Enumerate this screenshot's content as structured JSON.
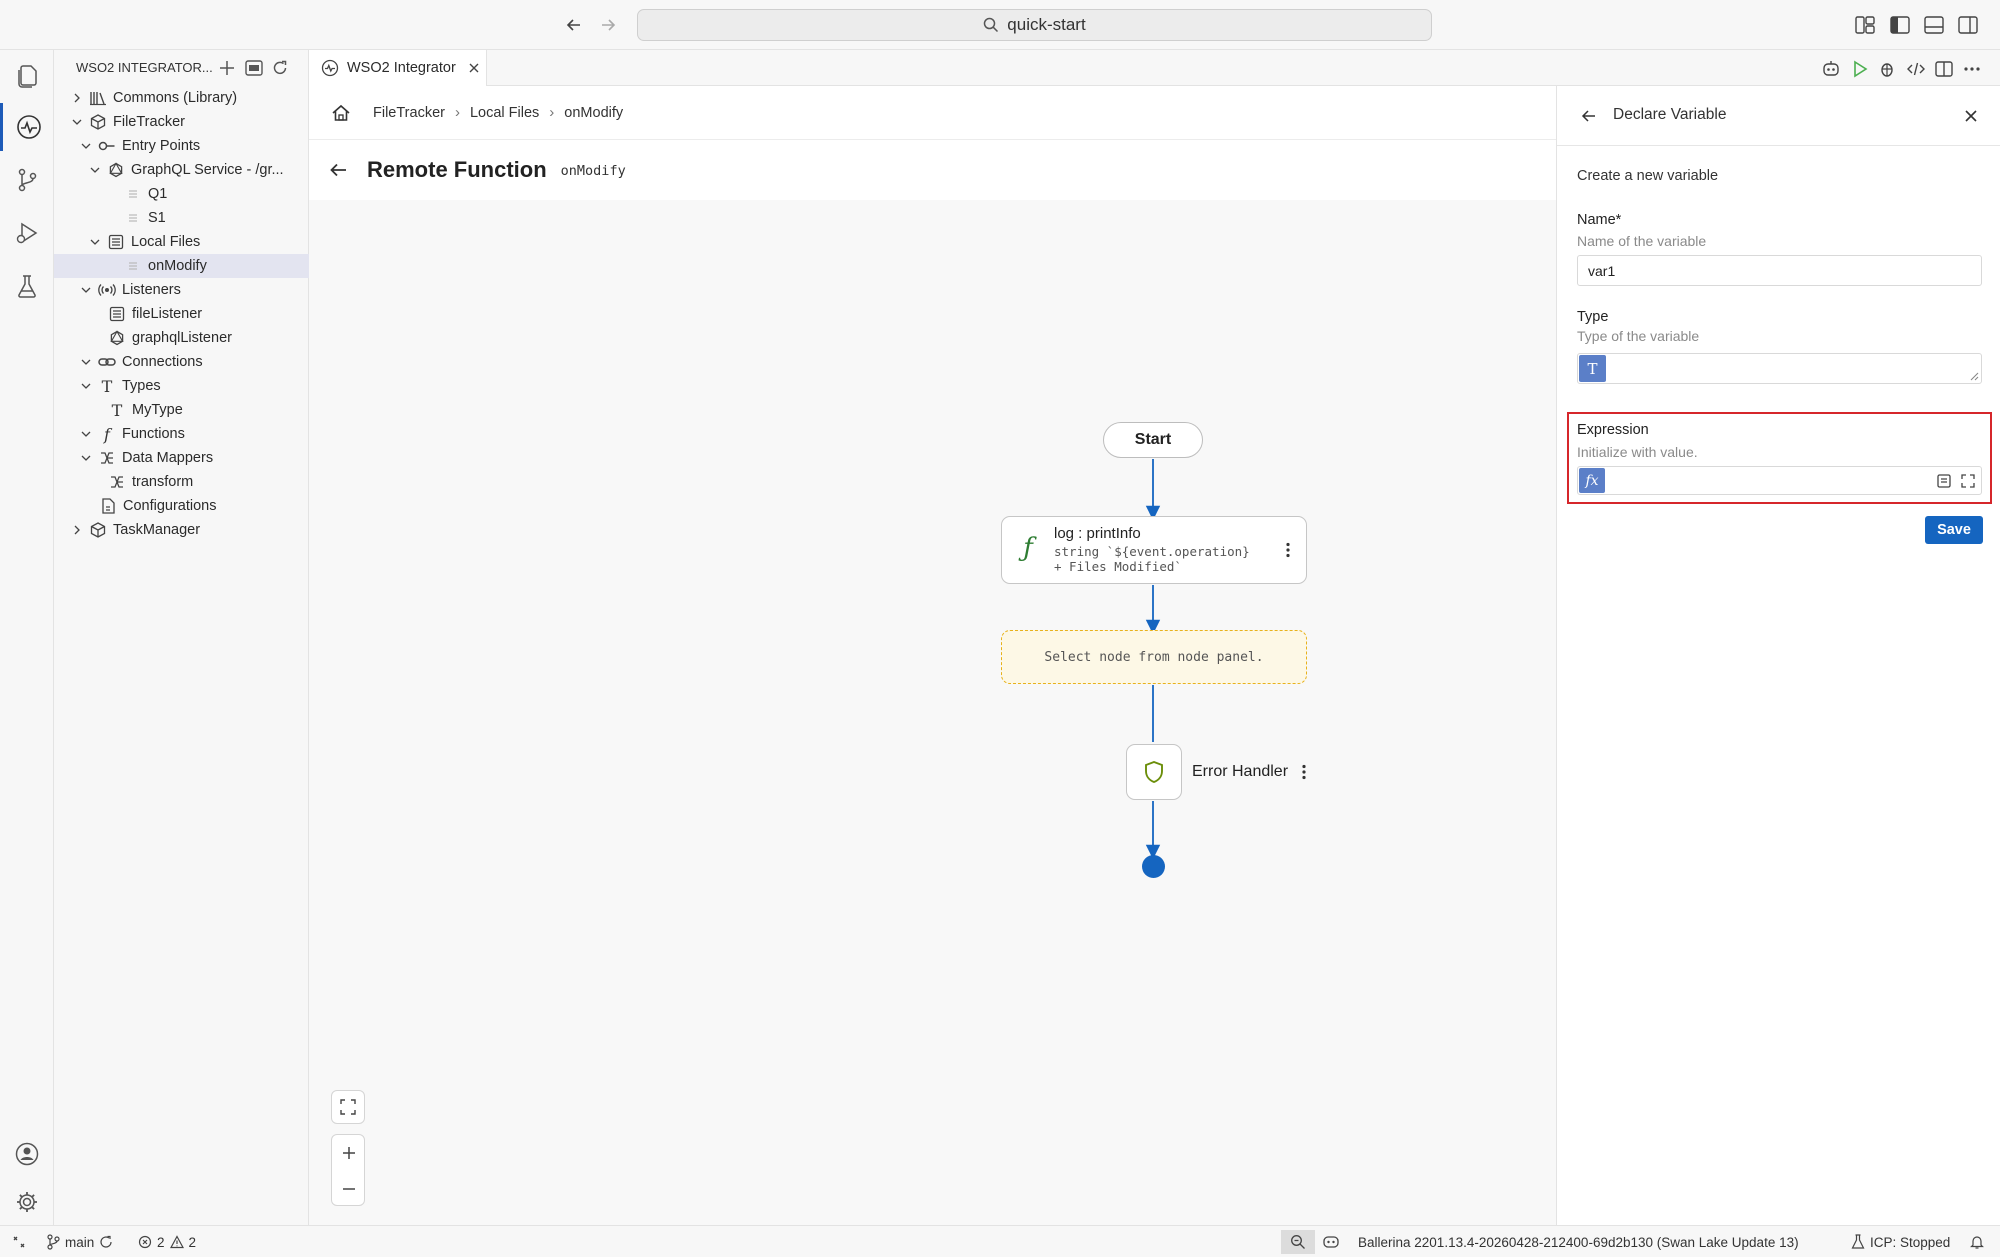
{
  "titlebar": {
    "search_text": "quick-start"
  },
  "explorer": {
    "header_title": "WSO2 INTEGRATOR...",
    "tree": [
      {
        "label": "Commons (Library)",
        "icon": "library-icon"
      },
      {
        "label": "FileTracker",
        "icon": "package-icon"
      },
      {
        "label": "Entry Points",
        "icon": "entry-points-icon"
      },
      {
        "label": "GraphQL Service - /gr...",
        "icon": "graphql-icon"
      },
      {
        "label": "Q1",
        "icon": "resource-icon"
      },
      {
        "label": "S1",
        "icon": "resource-icon"
      },
      {
        "label": "Local Files",
        "icon": "file-service-icon"
      },
      {
        "label": "onModify",
        "icon": "resource-icon"
      },
      {
        "label": "Listeners",
        "icon": "listener-icon"
      },
      {
        "label": "fileListener",
        "icon": "file-listener-icon"
      },
      {
        "label": "graphqlListener",
        "icon": "graphql-icon"
      },
      {
        "label": "Connections",
        "icon": "link-icon"
      },
      {
        "label": "Types",
        "icon": "type-icon"
      },
      {
        "label": "MyType",
        "icon": "type-icon"
      },
      {
        "label": "Functions",
        "icon": "function-icon"
      },
      {
        "label": "Data Mappers",
        "icon": "data-mapper-icon"
      },
      {
        "label": "transform",
        "icon": "data-mapper-icon"
      },
      {
        "label": "Configurations",
        "icon": "config-file-icon"
      },
      {
        "label": "TaskManager",
        "icon": "package-icon"
      }
    ]
  },
  "editor": {
    "tab_label": "WSO2 Integrator",
    "breadcrumb": [
      "FileTracker",
      "Local Files",
      "onModify"
    ],
    "page_title": "Remote Function",
    "page_subtitle": "onModify"
  },
  "flow": {
    "start_label": "Start",
    "log_title": "log : printInfo",
    "log_desc_line1": "string `${event.operation}",
    "log_desc_line2": "+ Files Modified`",
    "placeholder_text": "Select node from node panel.",
    "error_handler_label": "Error Handler"
  },
  "panel": {
    "title": "Declare Variable",
    "intro": "Create a new variable",
    "name_label": "Name*",
    "name_help": "Name of the variable",
    "name_value": "var1",
    "type_label": "Type",
    "type_help": "Type of the variable",
    "type_badge": "T",
    "expression_label": "Expression",
    "expression_help": "Initialize with value.",
    "expression_badge": "fx",
    "save_label": "Save"
  },
  "statusbar": {
    "branch": "main",
    "errors": "2",
    "warnings": "2",
    "ballerina_version": "Ballerina 2201.13.4-20260428-212400-69d2b130 (Swan Lake Update 13)",
    "icp_status": "ICP: Stopped"
  },
  "colors": {
    "accent": "#1565c0",
    "highlight_box": "#d6262b",
    "placeholder_border": "#e8b21c",
    "function_green": "#2e7d32"
  }
}
